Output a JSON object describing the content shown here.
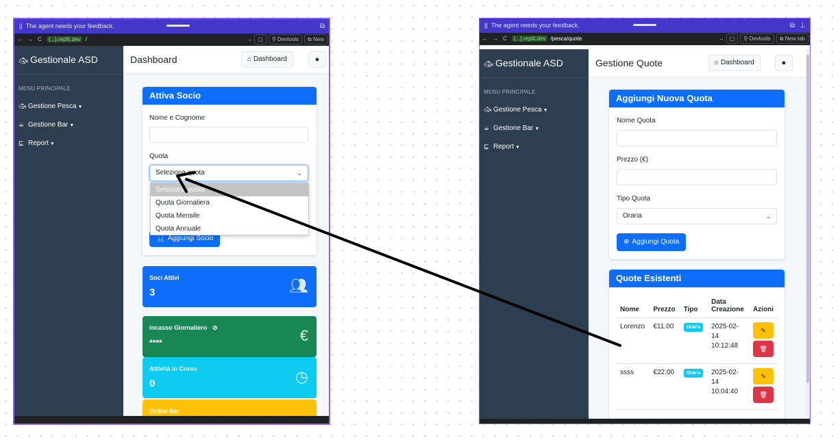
{
  "left": {
    "banner": "The agent needs your feedback.",
    "url": {
      "host": "{...}.replit.dev",
      "path": "/"
    },
    "browser": {
      "devtools": "Devtools",
      "newtab": "New"
    },
    "sidebar": {
      "brand": "Gestionale ASD",
      "section": "MENU PRINCIPALE",
      "items": [
        {
          "label": "Gestione Pesca"
        },
        {
          "label": "Gestione Bar"
        },
        {
          "label": "Report"
        }
      ]
    },
    "header": {
      "title": "Dashboard",
      "dashboard_btn": "Dashboard"
    },
    "form": {
      "title": "Attiva Socio",
      "name_label": "Nome e Cognome",
      "quota_label": "Quota",
      "quota_value": "Seleziona quota",
      "options": [
        "Seleziona quota",
        "Quota Giornaliera",
        "Quota Mensile",
        "Quota Annuale"
      ],
      "submit": "Aggiungi Socio"
    },
    "stats": [
      {
        "title": "Soci Attivi",
        "value": "3",
        "color": "#0d6efd"
      },
      {
        "title": "Incasso Giornaliero",
        "value": "****",
        "color": "#198754"
      },
      {
        "title": "Attività in Corso",
        "value": "0",
        "color": "#0dcaf0"
      },
      {
        "title": "Ordini Bar",
        "color": "#ffc107"
      }
    ]
  },
  "right": {
    "banner": "The agent needs your feedback.",
    "url": {
      "host": "{...}.replit.dev",
      "path": "/pesca/quote"
    },
    "browser": {
      "devtools": "Devtools",
      "newtab": "New tab"
    },
    "sidebar": {
      "brand": "Gestionale ASD",
      "section": "MENU PRINCIPALE",
      "items": [
        {
          "label": "Gestione Pesca"
        },
        {
          "label": "Gestione Bar"
        },
        {
          "label": "Report"
        }
      ]
    },
    "header": {
      "title": "Gestione Quote",
      "dashboard_btn": "Dashboard"
    },
    "add_form": {
      "title": "Aggiungi Nuova Quota",
      "name_label": "Nome Quota",
      "price_label": "Prezzo (€)",
      "type_label": "Tipo Quota",
      "type_value": "Oraria",
      "submit": "Aggiungi Quota"
    },
    "list": {
      "title": "Quote Esistenti",
      "headers": {
        "nome": "Nome",
        "prezzo": "Prezzo",
        "tipo": "Tipo",
        "data1": "Data",
        "data2": "Creazione",
        "azioni": "Azioni"
      },
      "rows": [
        {
          "nome": "Lorenzo",
          "prezzo": "€11.00",
          "tipo": "Oraria",
          "d1": "2025-02-",
          "d2": "14",
          "d3": "10:12:48"
        },
        {
          "nome": "ssss",
          "prezzo": "€22.00",
          "tipo": "Oraria",
          "d1": "2025-02-",
          "d2": "14",
          "d3": "10:04:40"
        }
      ]
    }
  },
  "colors": {
    "sidebar": "#2c3e50",
    "primary": "#0d6efd",
    "frame": "#8b5cf6",
    "banner": "#4338ca"
  }
}
